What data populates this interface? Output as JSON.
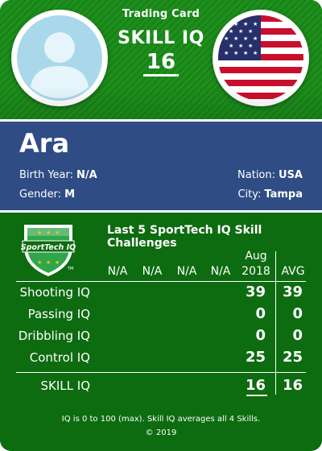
{
  "header": {
    "card_title": "Trading Card",
    "skill_label": "SKILL IQ",
    "skill_value": "16"
  },
  "player": {
    "name": "Ara",
    "birth_year_label": "Birth Year:",
    "birth_year": "N/A",
    "gender_label": "Gender:",
    "gender": "M",
    "nation_label": "Nation:",
    "nation": "USA",
    "city_label": "City:",
    "city": "Tampa"
  },
  "logo": {
    "text": "SportTech IQ",
    "tm": "TM"
  },
  "challenges": {
    "title": "Last 5 SportTech IQ Skill Challenges",
    "columns": [
      "N/A",
      "N/A",
      "N/A",
      "N/A"
    ],
    "latest_col_month": "Aug",
    "latest_col_year": "2018",
    "avg_label": "AVG",
    "rows": [
      {
        "label": "Shooting IQ",
        "latest": "39",
        "avg": "39"
      },
      {
        "label": "Passing IQ",
        "latest": "0",
        "avg": "0"
      },
      {
        "label": "Dribbling IQ",
        "latest": "0",
        "avg": "0"
      },
      {
        "label": "Control IQ",
        "latest": "25",
        "avg": "25"
      }
    ],
    "total": {
      "label": "SKILL IQ",
      "latest": "16",
      "avg": "16"
    }
  },
  "footer": {
    "note": "IQ is 0 to 100 (max). Skill IQ averages all 4 Skills.",
    "copyright": "© 2019"
  },
  "colors": {
    "field_green": "#1f8f1d",
    "band_blue": "#2f4c85",
    "table_green": "#0d6b10",
    "avatar_blue": "#a9d8ea"
  }
}
